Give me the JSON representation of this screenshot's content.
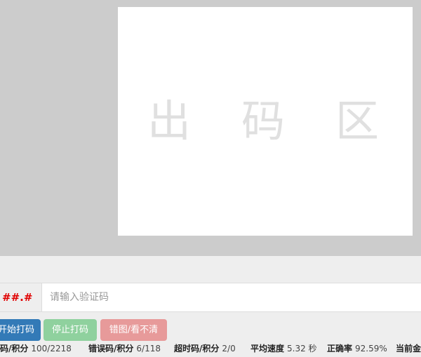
{
  "captcha_area": {
    "placeholder_chars": [
      "出",
      "码",
      "区"
    ]
  },
  "input_row": {
    "code_prefix": "##.#",
    "input_placeholder": "请输入验证码",
    "input_value": ""
  },
  "buttons": {
    "start_label": "开始打码",
    "stop_label": "停止打码",
    "error_label": "错图/看不清"
  },
  "stats": [
    {
      "label": "确码/积分",
      "value": "100/2218"
    },
    {
      "label": "错误码/积分",
      "value": "6/118"
    },
    {
      "label": "超时码/积分",
      "value": "2/0"
    },
    {
      "label": "平均速度",
      "value": "5.32 秒"
    },
    {
      "label": "正确率",
      "value": "92.59%"
    },
    {
      "label": "当前金",
      "value": ""
    }
  ],
  "colors": {
    "start_button": "#337ab7",
    "stop_button": "#8fd19e",
    "error_button": "#e79a9a",
    "code_prefix": "#e00000"
  }
}
